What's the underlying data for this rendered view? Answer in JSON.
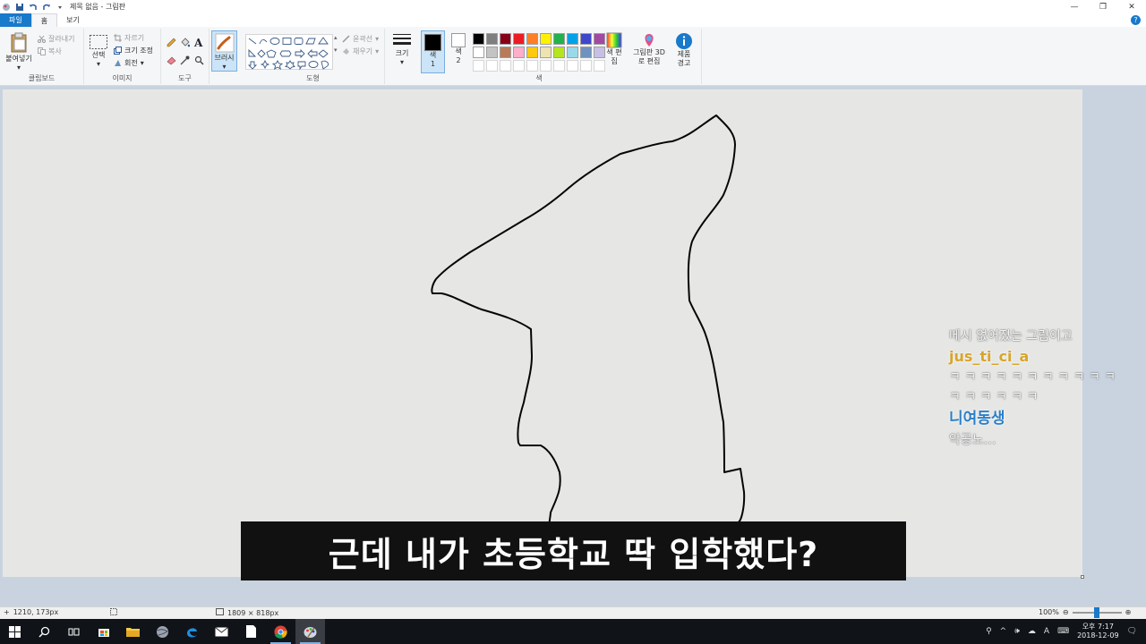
{
  "window": {
    "title": "제목 없음 - 그림판",
    "controls": [
      "—",
      "❐",
      "✕"
    ]
  },
  "tabs": [
    {
      "label": "파일"
    },
    {
      "label": "홈"
    },
    {
      "label": "보기"
    }
  ],
  "ribbon": {
    "clipboard": {
      "group": "클립보드",
      "paste": "붙여넣기",
      "cut": "잘라내기",
      "copy": "복사"
    },
    "image": {
      "group": "이미지",
      "select": "선택",
      "crop": "자르기",
      "resize": "크기 조정",
      "rotate": "회전"
    },
    "tools": {
      "group": "도구"
    },
    "brushes": {
      "label": "브러시"
    },
    "shapes": {
      "group": "도형",
      "outline": "윤곽선",
      "fill": "채우기"
    },
    "size": {
      "label": "크기"
    },
    "colors": {
      "group": "색",
      "color1": "색 1",
      "color2": "색 2",
      "edit": "색 편집",
      "paint3d": "그림판 3D로 편집",
      "product_alert": "제품 경고",
      "palette": [
        "#000000",
        "#7f7f7f",
        "#880015",
        "#ed1c24",
        "#ff7f27",
        "#fff200",
        "#22b14c",
        "#00a2e8",
        "#3f48cc",
        "#a349a4",
        "#ffffff",
        "#c3c3c3",
        "#b97a57",
        "#ffaec9",
        "#ffc90e",
        "#efe4b0",
        "#b5e61d",
        "#99d9ea",
        "#7092be",
        "#c8bfe7"
      ]
    }
  },
  "chat": {
    "line1": "메시 없어졌는 그림이고",
    "user1": "jus_ti_ci_a",
    "line2": "ㅋ ㅋ ㅋ ㅋ ㅋ ㅋ ㅋ ㅋ ㅋ ㅋ ㅋ",
    "line3": "ㅋ ㅋ ㅋ ㅋ ㅋ ㅋ",
    "user2": "니여동생",
    "line4": "악공노…"
  },
  "subtitle": "근데 내가 초등학교 딱 입학했다?",
  "status": {
    "cursor": "1210, 173px",
    "canvas_size": "1809 × 818px",
    "zoom": "100%"
  },
  "taskbar": {
    "time": "오후 7:17",
    "date": "2018-12-09",
    "lang": "A"
  }
}
